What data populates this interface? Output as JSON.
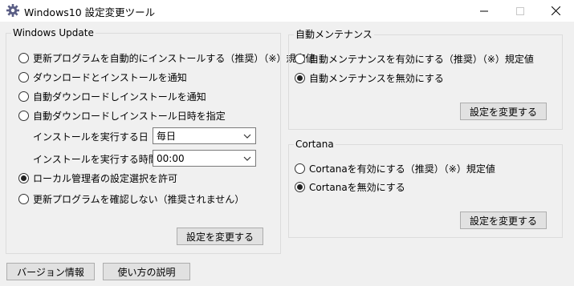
{
  "window": {
    "title": "Windows10 設定変更ツール",
    "icon": "gear-icon",
    "controls": [
      "minimize-icon",
      "maximize-icon",
      "close-icon"
    ]
  },
  "windows_update": {
    "label": "Windows Update",
    "options": [
      {
        "label": "更新プログラムを自動的にインストールする（推奨）（※）規定値",
        "checked": false
      },
      {
        "label": "ダウンロードとインストールを通知",
        "checked": false
      },
      {
        "label": "自動ダウンロードしインストールを通知",
        "checked": false
      },
      {
        "label": "自動ダウンロードしインストール日時を指定",
        "checked": false
      },
      {
        "label": "ローカル管理者の設定選択を許可",
        "checked": true
      },
      {
        "label": "更新プログラムを確認しない（推奨されません）",
        "checked": false
      }
    ],
    "install_day_label": "インストールを実行する日",
    "install_day_value": "毎日",
    "install_time_label": "インストールを実行する時間",
    "install_time_value": "00:00",
    "apply_button": "設定を変更する"
  },
  "auto_maintenance": {
    "label": "自動メンテナンス",
    "options": [
      {
        "label": "自動メンテナンスを有効にする（推奨）（※）規定値",
        "checked": false
      },
      {
        "label": "自動メンテナンスを無効にする",
        "checked": true
      }
    ],
    "apply_button": "設定を変更する"
  },
  "cortana": {
    "label": "Cortana",
    "options": [
      {
        "label": "Cortanaを有効にする（推奨）（※）規定値",
        "checked": false
      },
      {
        "label": "Cortanaを無効にする",
        "checked": true
      }
    ],
    "apply_button": "設定を変更する"
  },
  "footer": {
    "version_button": "バージョン情報",
    "howto_button": "使い方の説明"
  }
}
